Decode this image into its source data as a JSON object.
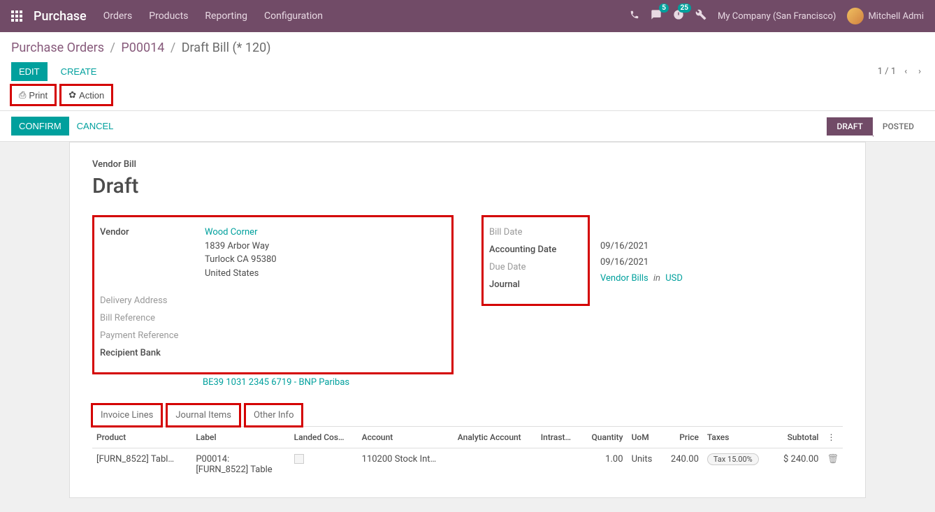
{
  "topbar": {
    "app_title": "Purchase",
    "menu": [
      "Orders",
      "Products",
      "Reporting",
      "Configuration"
    ],
    "messages_badge": "5",
    "activities_badge": "25",
    "company": "My Company (San Francisco)",
    "user": "Mitchell Admi"
  },
  "breadcrumb": {
    "items": [
      "Purchase Orders",
      "P00014"
    ],
    "current": "Draft Bill (* 120)"
  },
  "toolbar": {
    "edit": "EDIT",
    "create": "CREATE",
    "print": "Print",
    "action": "Action",
    "pager": "1 / 1"
  },
  "statusbar": {
    "confirm": "CONFIRM",
    "cancel": "CANCEL",
    "steps": [
      "DRAFT",
      "POSTED"
    ],
    "active_index": 0
  },
  "doc": {
    "subtitle": "Vendor Bill",
    "title": "Draft"
  },
  "left_fields": {
    "vendor_label": "Vendor",
    "vendor_name": "Wood Corner",
    "vendor_addr1": "1839 Arbor Way",
    "vendor_addr2": "Turlock CA 95380",
    "vendor_country": "United States",
    "delivery_label": "Delivery Address",
    "billref_label": "Bill Reference",
    "payref_label": "Payment Reference",
    "bank_label": "Recipient Bank",
    "bank_value": "BE39 1031 2345 6719 - BNP Paribas"
  },
  "right_fields": {
    "billdate_label": "Bill Date",
    "accdate_label": "Accounting Date",
    "accdate_value": "09/16/2021",
    "duedate_label": "Due Date",
    "duedate_value": "09/16/2021",
    "journal_label": "Journal",
    "journal_value": "Vendor Bills",
    "journal_in": "in",
    "journal_currency": "USD"
  },
  "tabs": [
    "Invoice Lines",
    "Journal Items",
    "Other Info"
  ],
  "table": {
    "headers": [
      "Product",
      "Label",
      "Landed Cos…",
      "Account",
      "Analytic Account",
      "Intrast…",
      "Quantity",
      "UoM",
      "Price",
      "Taxes",
      "Subtotal"
    ],
    "row": {
      "product": "[FURN_8522] Tabl…",
      "label_line1": "P00014:",
      "label_line2": "[FURN_8522] Table",
      "account": "110200 Stock Int…",
      "quantity": "1.00",
      "uom": "Units",
      "price": "240.00",
      "tax": "Tax 15.00%",
      "subtotal": "$ 240.00"
    }
  }
}
